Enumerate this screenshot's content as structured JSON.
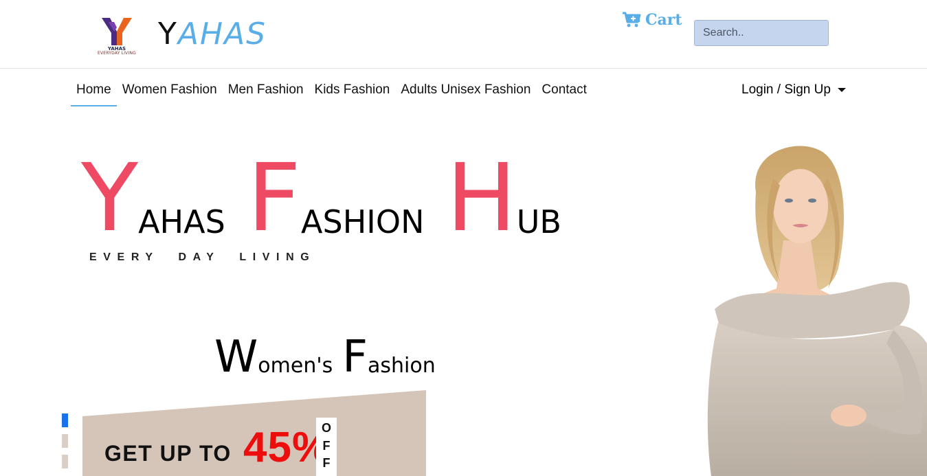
{
  "header": {
    "logo_brand_small": "YAHAS",
    "logo_tagline_small": "EVERYDAY LIVING",
    "brand_first_letter": "Y",
    "brand_rest": "AHAS",
    "cart_label": "Cart",
    "search_placeholder": "Search.."
  },
  "nav": {
    "items": [
      {
        "label": "Home",
        "active": true
      },
      {
        "label": "Women Fashion"
      },
      {
        "label": "Men Fashion"
      },
      {
        "label": "Kids Fashion"
      },
      {
        "label": "Adults Unisex Fashion"
      },
      {
        "label": "Contact"
      }
    ],
    "login_label": "Login / Sign Up"
  },
  "hero": {
    "word1_initial": "Y",
    "word1_rest": "AHAS",
    "word2_initial": "F",
    "word2_rest": "ASHION",
    "word3_initial": "H",
    "word3_rest": "UB",
    "tagline": "EVERY  DAY  LIVING",
    "section_initial1": "W",
    "section_rest1": "omen's",
    "section_initial2": "F",
    "section_rest2": "ashion"
  },
  "promo": {
    "text": "GET UP TO",
    "percent": "45%",
    "off_letters": [
      "O",
      "F",
      "F"
    ]
  },
  "carousel": {
    "slides": 3,
    "active_index": 0
  },
  "colors": {
    "accent_pink": "#ee4a64",
    "accent_blue": "#5aaee8",
    "promo_bg": "#d5c4b8",
    "promo_red": "#ee0d0d"
  },
  "icons": {
    "cart": "cart-plus-icon",
    "login_caret": "caret-down-icon"
  }
}
